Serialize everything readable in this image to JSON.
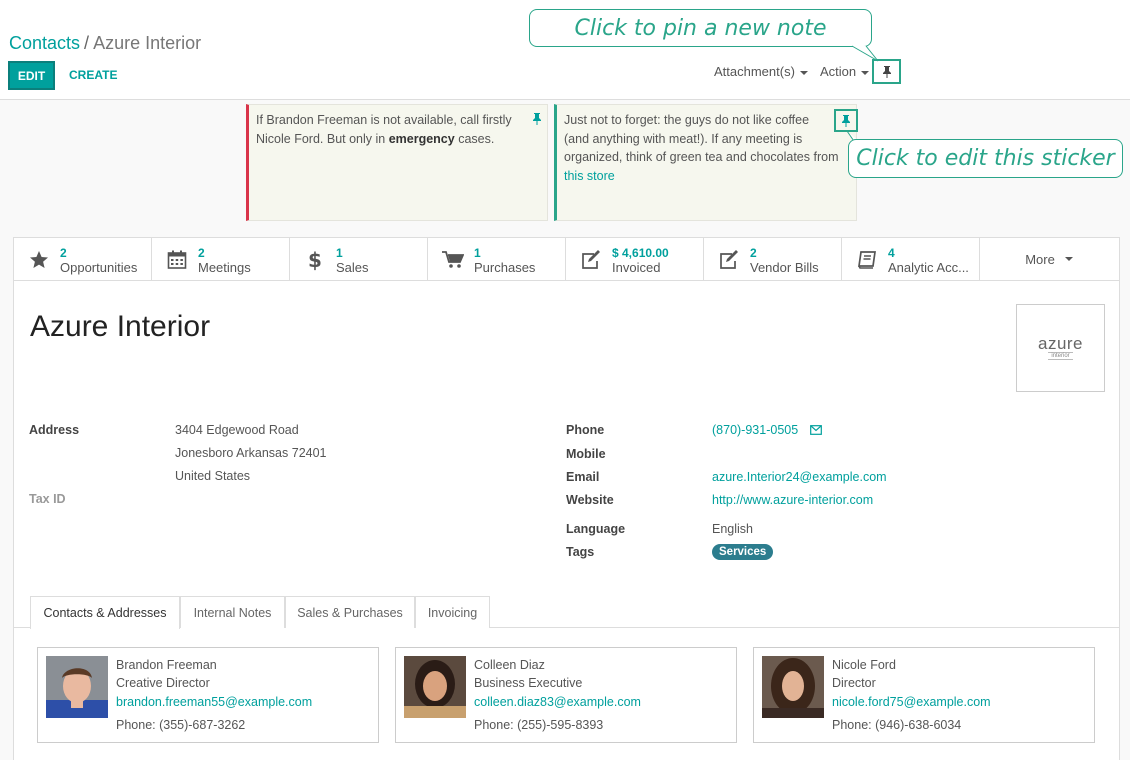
{
  "breadcrumb": {
    "parent": "Contacts",
    "separator": "/",
    "current": "Azure Interior"
  },
  "toolbar": {
    "edit": "EDIT",
    "create": "CREATE",
    "attachments": "Attachment(s)",
    "action": "Action"
  },
  "callouts": {
    "pin_new": "Click to pin a new note",
    "edit_sticker": "Click to edit this sticker"
  },
  "stickers": [
    {
      "line1": "If Brandon Freeman is not available, call firstly",
      "line2_pre": "Nicole Ford. But only in ",
      "line2_bold": "emergency",
      "line2_post": " cases."
    },
    {
      "line1": "Just not to forget: the guys do not like coffee",
      "line2": "(and anything with meat!). If any meeting is",
      "line3": "organized, think of green tea and chocolates from",
      "link": "this store"
    }
  ],
  "stats": [
    {
      "icon": "star-icon",
      "value": "2",
      "label": "Opportunities"
    },
    {
      "icon": "calendar-icon",
      "value": "2",
      "label": "Meetings"
    },
    {
      "icon": "dollar-icon",
      "value": "1",
      "label": "Sales"
    },
    {
      "icon": "cart-icon",
      "value": "1",
      "label": "Purchases"
    },
    {
      "icon": "pencil-square-icon",
      "value": "$ 4,610.00",
      "label": "Invoiced"
    },
    {
      "icon": "pencil-square-icon",
      "value": "2",
      "label": "Vendor Bills"
    },
    {
      "icon": "book-icon",
      "value": "4",
      "label": "Analytic Acc..."
    }
  ],
  "more": "More",
  "partner": {
    "name": "Azure Interior",
    "logo_main": "azure",
    "logo_sub": "interior",
    "address_label": "Address",
    "street": "3404 Edgewood Road",
    "city_line": "Jonesboro  Arkansas  72401",
    "country": "United States",
    "taxid_label": "Tax ID",
    "phone_label": "Phone",
    "phone": "(870)-931-0505",
    "mobile_label": "Mobile",
    "email_label": "Email",
    "email": "azure.Interior24@example.com",
    "website_label": "Website",
    "website": "http://www.azure-interior.com",
    "language_label": "Language",
    "language": "English",
    "tags_label": "Tags",
    "tag": "Services"
  },
  "tabs": [
    "Contacts & Addresses",
    "Internal Notes",
    "Sales & Purchases",
    "Invoicing"
  ],
  "contacts": [
    {
      "name": "Brandon Freeman",
      "title": "Creative Director",
      "email": "brandon.freeman55@example.com",
      "phone": "Phone: (355)-687-3262"
    },
    {
      "name": "Colleen Diaz",
      "title": "Business Executive",
      "email": "colleen.diaz83@example.com",
      "phone": "Phone: (255)-595-8393"
    },
    {
      "name": "Nicole Ford",
      "title": "Director",
      "email": "nicole.ford75@example.com",
      "phone": "Phone: (946)-638-6034"
    }
  ],
  "colors": {
    "accent": "#00A09D",
    "callout": "#2aa58a",
    "sticker_red": "#d9344a",
    "sticker_green": "#2aa58a",
    "tag_bg": "#2c7d8e"
  }
}
